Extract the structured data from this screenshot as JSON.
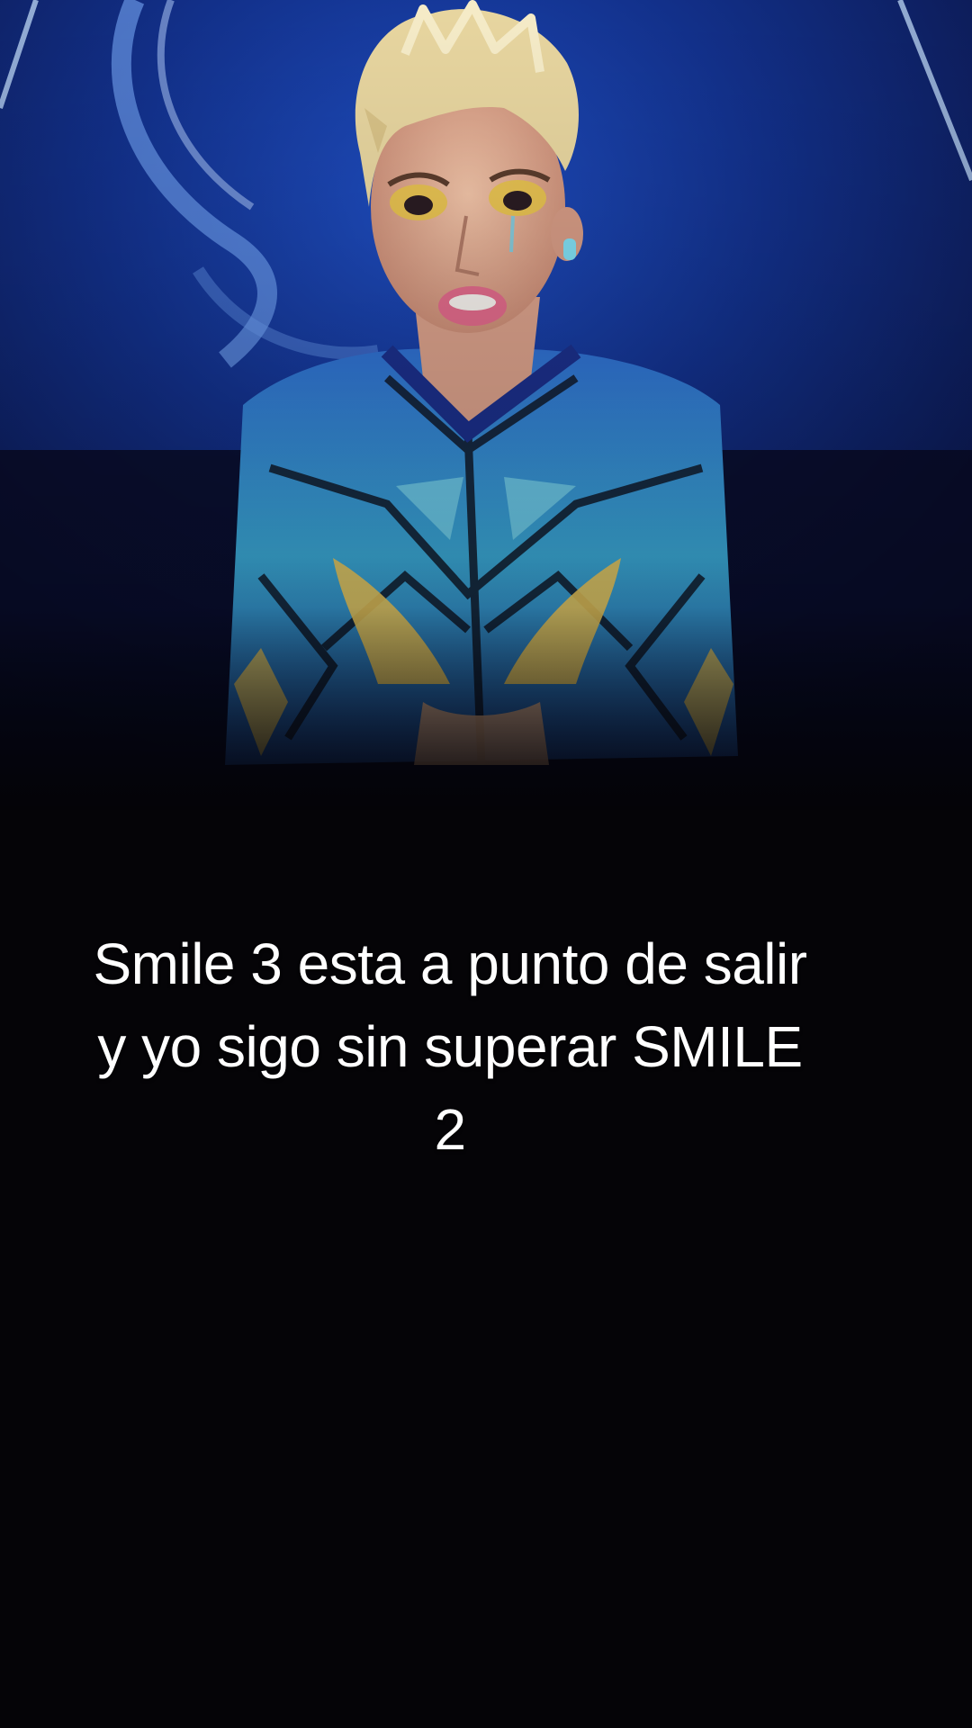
{
  "video": {
    "caption_lines": [
      "Smile 3 esta a punto de salir",
      "y yo sigo sin superar SMILE",
      "2"
    ]
  },
  "colors": {
    "background": "#050407",
    "screen_blue": "#123a9b",
    "costume_cyan": "#3fb8d8",
    "costume_yellow": "#e9c55a",
    "hair_blond": "#e8d6a0",
    "caption_text": "#ffffff"
  }
}
